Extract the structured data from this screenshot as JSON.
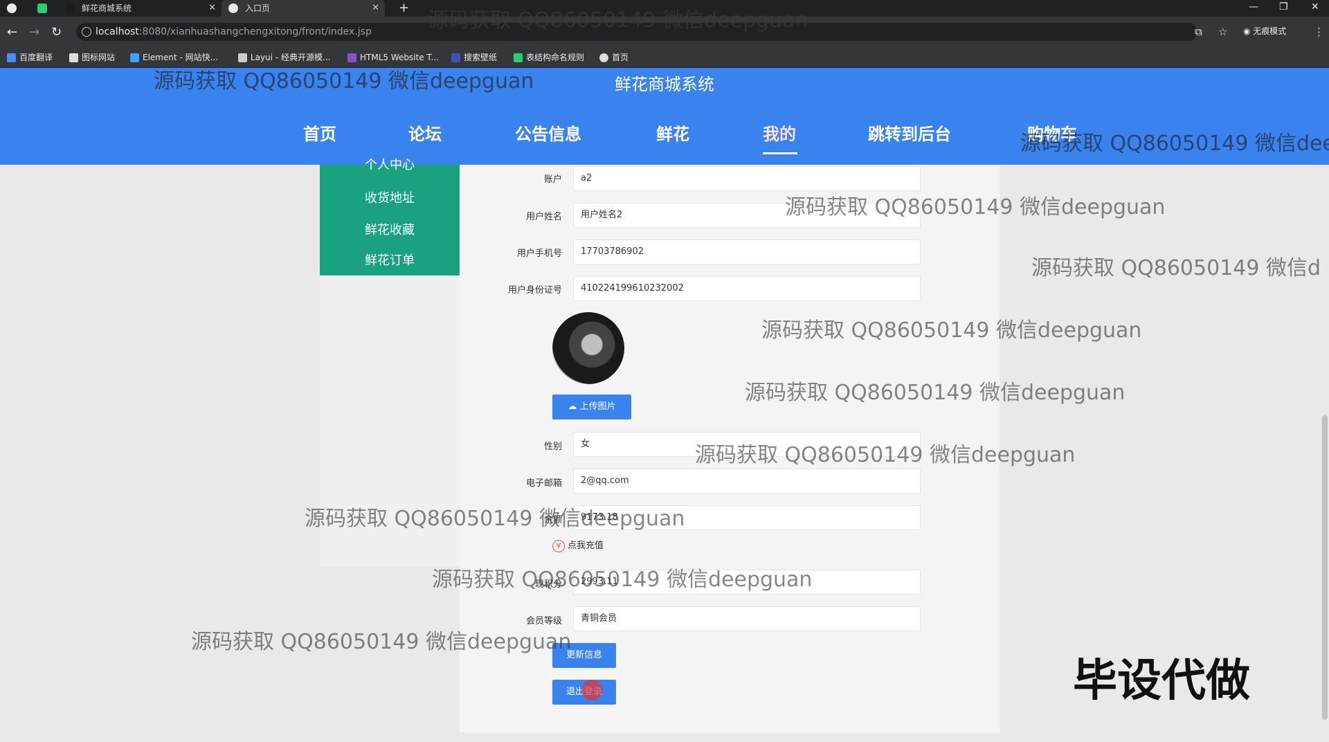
{
  "browser": {
    "tabs": [
      {
        "title": "鲜花商城系统"
      },
      {
        "title": "入口页"
      }
    ],
    "url_host": "localhost",
    "url_path": ":8080/xianhuashangchengxitong/front/index.jsp",
    "incognito_label": "无痕模式",
    "bookmarks": [
      "百度翻译",
      "图标网站",
      "Element - 网站快...",
      "Layui - 经典开源模...",
      "HTML5 Website T...",
      "搜索壁纸",
      "表结构命名规则",
      "首页"
    ]
  },
  "site": {
    "title": "鲜花商城系统",
    "menu": [
      "首页",
      "论坛",
      "公告信息",
      "鲜花",
      "我的",
      "跳转到后台",
      "购物车"
    ],
    "active_menu": "我的"
  },
  "sidebar": {
    "items": [
      "个人中心",
      "收货地址",
      "鲜花收藏",
      "鲜花订单"
    ]
  },
  "profile": {
    "account_label": "账户",
    "account_value": "a2",
    "name_label": "用户姓名",
    "name_value": "用户姓名2",
    "phone_label": "用户手机号",
    "phone_value": "17703786902",
    "idcard_label": "用户身份证号",
    "idcard_value": "410224199610232002",
    "upload_label": "上传图片",
    "gender_label": "性别",
    "gender_value": "女",
    "email_label": "电子邮箱",
    "email_value": "2@qq.com",
    "balance_label": "余额",
    "balance_value": "9173.18",
    "recharge_label": "点我充值",
    "points_label": "现积分",
    "points_value": "2993.11",
    "level_label": "会员等级",
    "level_value": "青铜会员",
    "update_label": "更新信息",
    "logout_label": "退出登录"
  },
  "watermark": {
    "text": "源码获取 QQ86050149 微信deepguan",
    "big_text": "毕设代做"
  },
  "colors": {
    "brand": "#3a82ee",
    "sidebar": "#1aa17d"
  }
}
